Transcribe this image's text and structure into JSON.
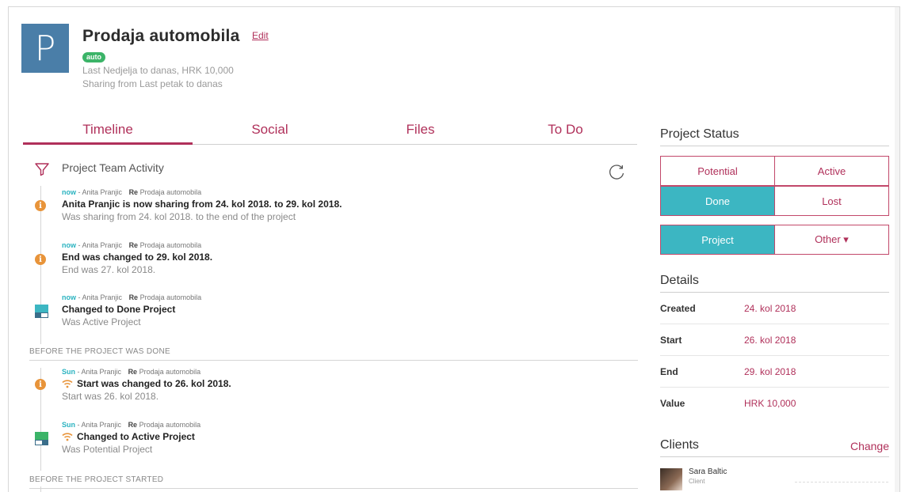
{
  "project": {
    "avatar_letter": "P",
    "title": "Prodaja automobila",
    "edit_label": "Edit",
    "badge": "auto",
    "line1": "Last Nedjelja to danas, HRK 10,000",
    "line2": "Sharing from Last petak to danas"
  },
  "tabs": [
    "Timeline",
    "Social",
    "Files",
    "To Do"
  ],
  "activity": {
    "title": "Project Team Activity",
    "sections": {
      "before_done": "BEFORE THE PROJECT WAS DONE",
      "before_started": "BEFORE THE PROJECT STARTED"
    },
    "entries": [
      {
        "when": "now",
        "who": "Anita Pranjic",
        "re_label": "Re",
        "re": "Prodaja automobila",
        "headline": "Anita Pranjic is now sharing from 24. kol 2018. to 29. kol 2018.",
        "detail": "Was sharing from 24. kol 2018. to the end of the project",
        "icon": "info-icon"
      },
      {
        "when": "now",
        "who": "Anita Pranjic",
        "re_label": "Re",
        "re": "Prodaja automobila",
        "headline": "End was changed to 29. kol 2018.",
        "detail": "End was 27. kol 2018.",
        "icon": "info-icon"
      },
      {
        "when": "now",
        "who": "Anita Pranjic",
        "re_label": "Re",
        "re": "Prodaja automobila",
        "headline": "Changed to Done Project",
        "detail": "Was Active Project",
        "icon": "status-done-icon"
      },
      {
        "when": "Sun",
        "who": "Anita Pranjic",
        "re_label": "Re",
        "re": "Prodaja automobila",
        "headline": "Start was changed to 26. kol 2018.",
        "detail": "Start was 26. kol 2018.",
        "icon": "info-icon"
      },
      {
        "when": "Sun",
        "who": "Anita Pranjic",
        "re_label": "Re",
        "re": "Prodaja automobila",
        "headline": "Changed to Active Project",
        "detail": "Was Potential Project",
        "icon": "status-active-icon"
      }
    ]
  },
  "status": {
    "heading": "Project Status",
    "options": [
      "Potential",
      "Active",
      "Done",
      "Lost"
    ],
    "selected": "Done",
    "type_options": [
      "Project",
      "Other ▾"
    ],
    "type_selected": "Project"
  },
  "details": {
    "heading": "Details",
    "rows": [
      {
        "label": "Created",
        "value": "24. kol 2018"
      },
      {
        "label": "Start",
        "value": "26. kol 2018"
      },
      {
        "label": "End",
        "value": "29. kol 2018"
      },
      {
        "label": "Value",
        "value": "HRK 10,000"
      }
    ]
  },
  "clients": {
    "heading": "Clients",
    "change_label": "Change",
    "items": [
      {
        "name": "Sara Baltic",
        "role": "Client"
      }
    ]
  },
  "colors": {
    "accent": "#b0305a",
    "teal": "#3cb6c2",
    "avatar": "#4a7ea8",
    "badge": "#3bb468",
    "info": "#e8943a"
  }
}
